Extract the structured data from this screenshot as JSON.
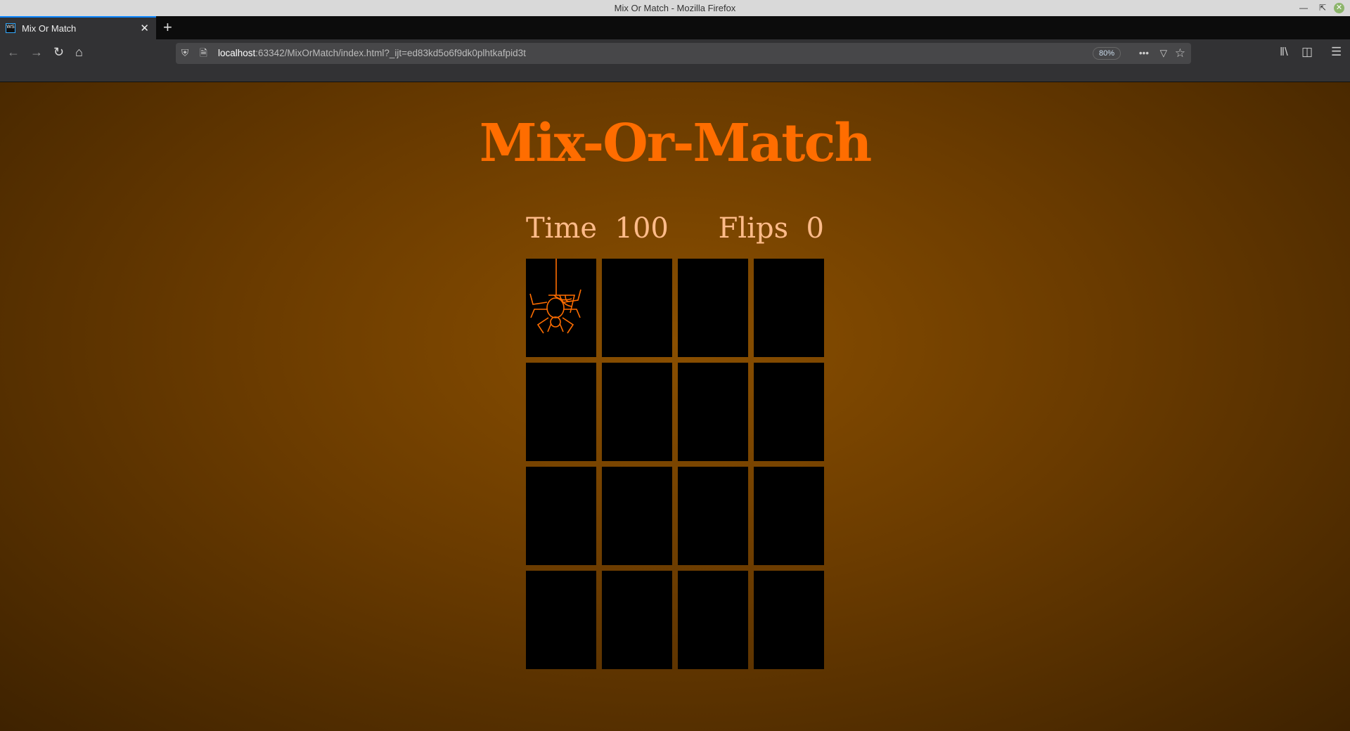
{
  "window": {
    "title": "Mix Or Match - Mozilla Firefox"
  },
  "tab": {
    "label": "Mix Or Match",
    "favicon": "WS"
  },
  "urlbar": {
    "host": "localhost",
    "path": ":63342/MixOrMatch/index.html?_ijt=ed83kd5o6f9dk0plhtkafpid3t",
    "zoom": "80%"
  },
  "game": {
    "title": "Mix-Or-Match",
    "time_label": "Time",
    "time_value": "100",
    "flips_label": "Flips",
    "flips_value": "0",
    "cards": [
      {
        "state": "back",
        "icon": "spider-icon"
      },
      {
        "state": "blank"
      },
      {
        "state": "blank"
      },
      {
        "state": "blank"
      },
      {
        "state": "blank"
      },
      {
        "state": "blank"
      },
      {
        "state": "blank"
      },
      {
        "state": "blank"
      },
      {
        "state": "blank"
      },
      {
        "state": "blank"
      },
      {
        "state": "blank"
      },
      {
        "state": "blank"
      },
      {
        "state": "blank"
      },
      {
        "state": "blank"
      },
      {
        "state": "blank"
      },
      {
        "state": "blank"
      }
    ],
    "colors": {
      "accent": "#ff6d00",
      "text": "#ffbb89",
      "card": "#000000"
    }
  }
}
